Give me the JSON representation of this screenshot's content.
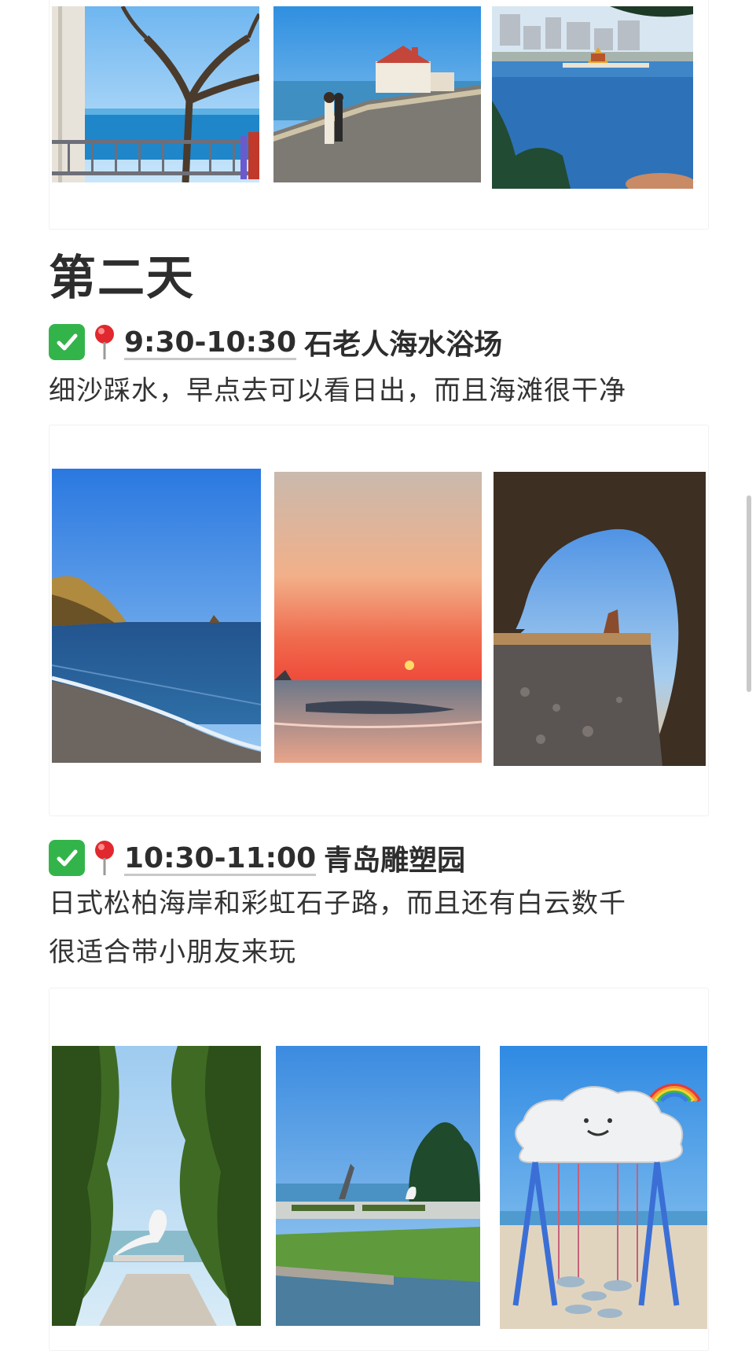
{
  "section": {
    "day_title": "第二天",
    "items": [
      {
        "time": "9:30-10:30",
        "place": "石老人海水浴场",
        "description": "细沙踩水，早点去可以看日出，而且海滩很干净"
      },
      {
        "time": "10:30-11:00",
        "place": "青岛雕塑园",
        "description_lines": [
          "日式松柏海岸和彩虹石子路，而且还有白云数千",
          "很适合带小朋友来玩"
        ]
      }
    ]
  },
  "icons": {
    "check": "white-heavy-check-mark-icon",
    "pin": "round-pushpin-icon"
  },
  "colors": {
    "check_green": "#33b44a",
    "pin_red": "#e0282e",
    "text": "#2d2d2d",
    "panel_border": "#f1f1f1"
  }
}
